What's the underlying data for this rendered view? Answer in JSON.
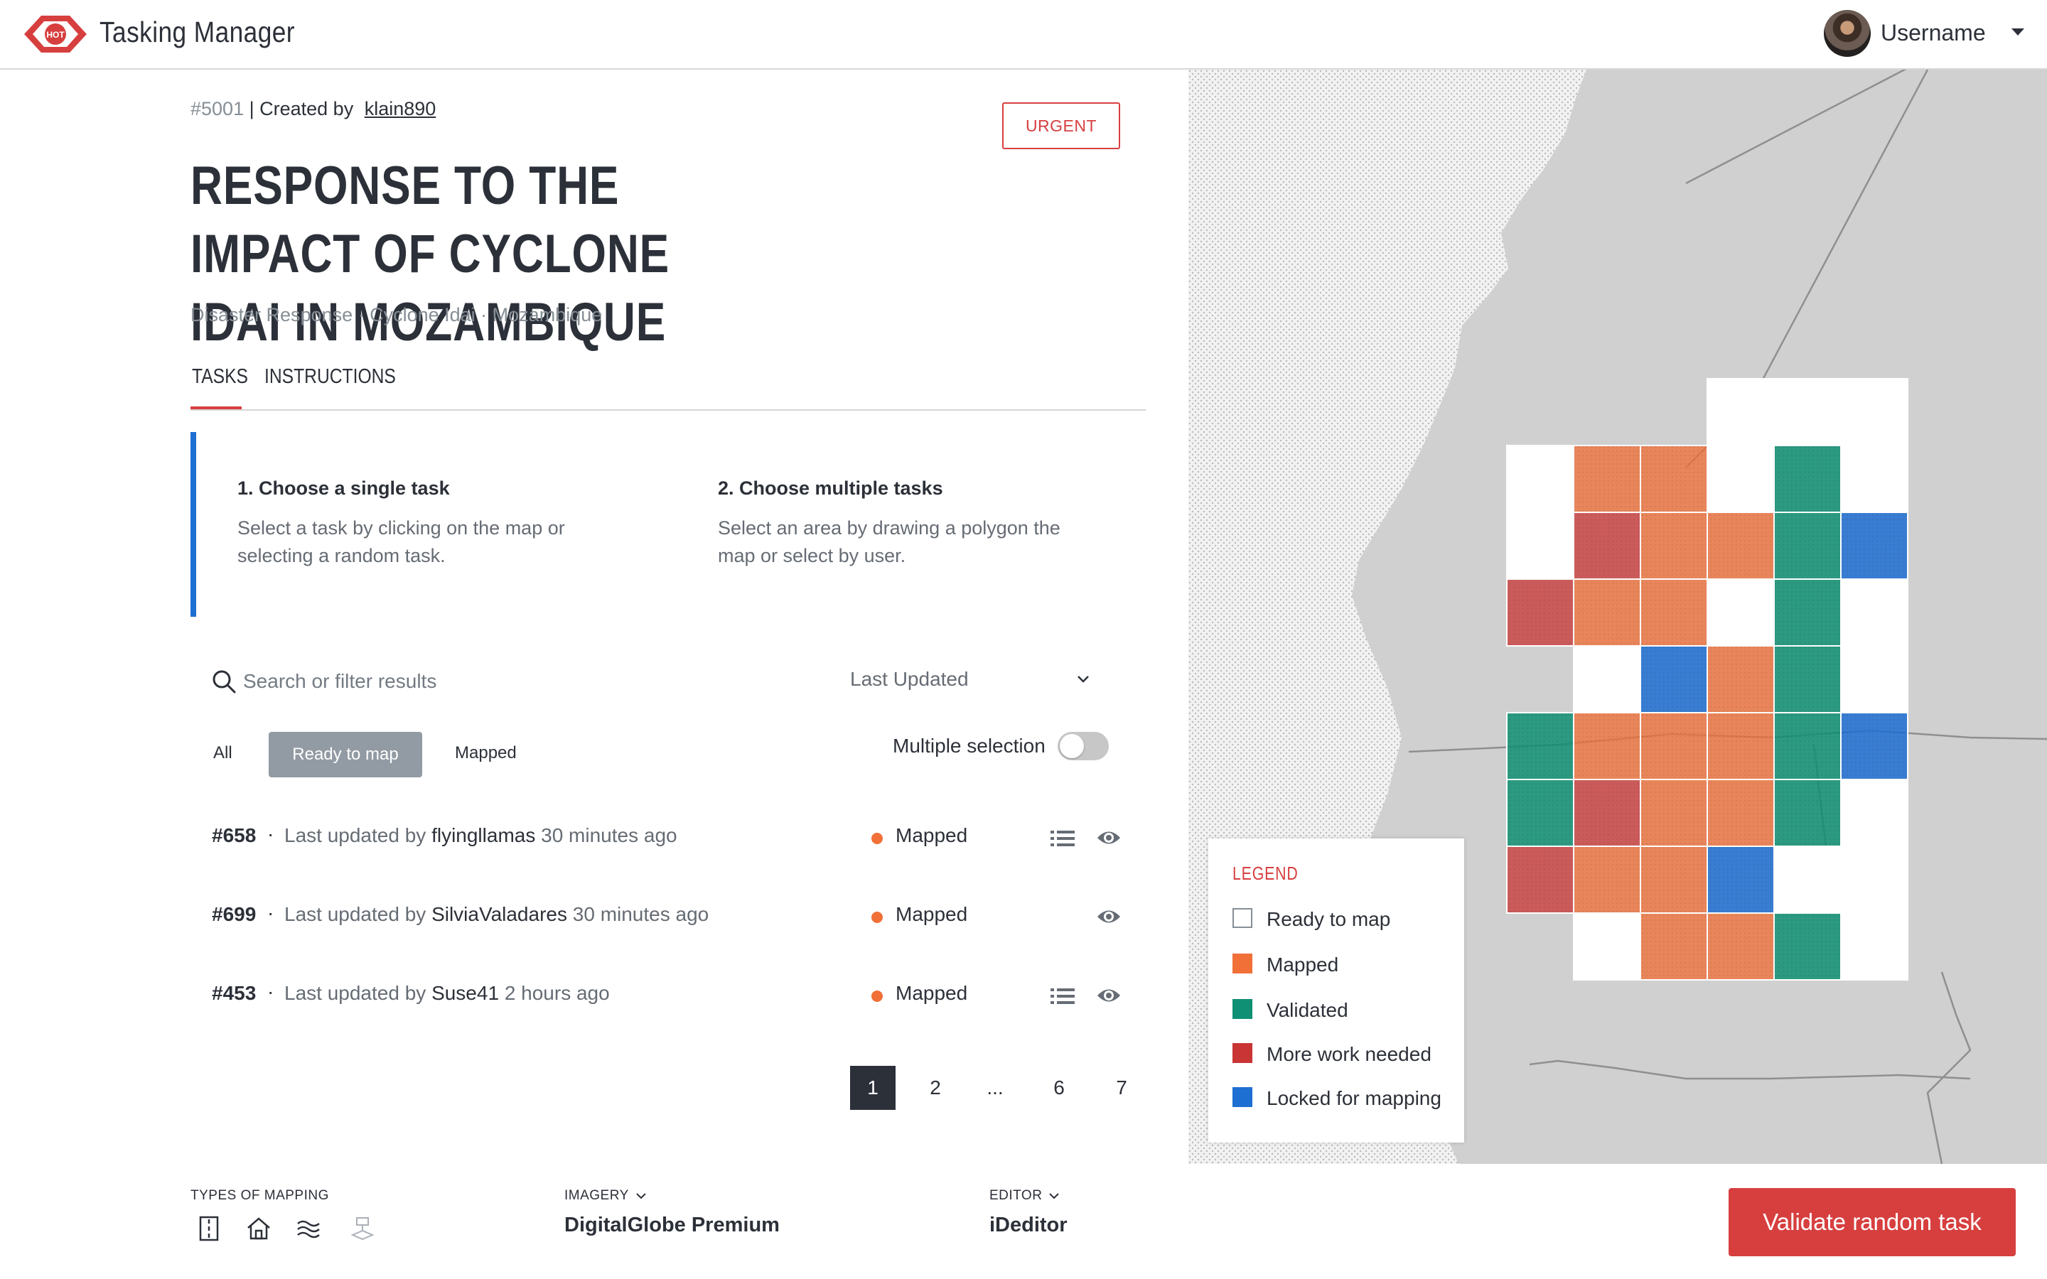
{
  "header": {
    "logo_text": "HOT",
    "app_title": "Tasking Manager",
    "username": "Username"
  },
  "project": {
    "id": "#5001",
    "created_by_label": "| Created by",
    "creator": "klain890",
    "badge": "URGENT",
    "title": "RESPONSE TO THE IMPACT OF CYCLONE IDAI IN MOZAMBIQUE",
    "tags": "Disaster Response · Cyclone Idai · Mozambique"
  },
  "tabs": [
    {
      "label": "TASKS",
      "active": true
    },
    {
      "label": "INSTRUCTIONS",
      "active": false
    }
  ],
  "info": {
    "single_title": "1. Choose a single task",
    "single_text": "Select a task by clicking on the map or selecting a random task.",
    "multi_title": "2. Choose multiple tasks",
    "multi_text": "Select an area by drawing a polygon the map or select by user."
  },
  "search": {
    "placeholder": "Search or filter results",
    "sort_label": "Last Updated"
  },
  "filters": {
    "all": "All",
    "ready": "Ready to map",
    "mapped": "Mapped",
    "active": "Ready to map"
  },
  "multiple_selection": {
    "label": "Multiple selection",
    "enabled": false
  },
  "tasks": [
    {
      "id": "#658",
      "sep": "·",
      "updated_prefix": "Last updated by",
      "user": "flyingllamas",
      "time": "30 minutes ago",
      "status": "Mapped",
      "has_list": true
    },
    {
      "id": "#699",
      "sep": "·",
      "updated_prefix": "Last updated by",
      "user": "SilviaValadares",
      "time": "30 minutes ago",
      "status": "Mapped",
      "has_list": false
    },
    {
      "id": "#453",
      "sep": "·",
      "updated_prefix": "Last updated by",
      "user": "Suse41",
      "time": "2 hours ago",
      "status": "Mapped",
      "has_list": true
    }
  ],
  "pagination": [
    "1",
    "2",
    "...",
    "6",
    "7"
  ],
  "pagination_active": "1",
  "footer": {
    "types_label": "TYPES OF MAPPING",
    "imagery_label": "IMAGERY",
    "imagery_value": "DigitalGlobe Premium",
    "editor_label": "EDITOR",
    "editor_value": "iDeditor",
    "mapping_type_icons": [
      "road-icon",
      "building-icon",
      "waterway-icon",
      "land-use-icon"
    ]
  },
  "validate_button": "Validate random task",
  "legend": {
    "title": "LEGEND",
    "items": [
      {
        "label": "Ready to map",
        "color": "#ffffff"
      },
      {
        "label": "Mapped",
        "color": "#f07038"
      },
      {
        "label": "Validated",
        "color": "#0f8f73"
      },
      {
        "label": "More work needed",
        "color": "#c93434"
      },
      {
        "label": "Locked for mapping",
        "color": "#1e6fd2"
      }
    ]
  },
  "colors": {
    "accent": "#d73f3f",
    "info_border": "#1e6fd2",
    "text": "#2c3038",
    "muted": "#868e96"
  },
  "task_grid": [
    [
      null,
      null,
      null,
      "ready",
      "ready",
      "ready"
    ],
    [
      "ready",
      "mapped",
      "mapped",
      "ready",
      "validated",
      "ready"
    ],
    [
      "ready",
      "more_work",
      "mapped",
      "mapped",
      "validated",
      "locked"
    ],
    [
      "more_work",
      "mapped",
      "mapped",
      "ready",
      "validated",
      "ready"
    ],
    [
      null,
      "ready",
      "locked",
      "mapped",
      "validated",
      "ready"
    ],
    [
      "validated",
      "mapped",
      "mapped",
      "mapped",
      "validated",
      "locked"
    ],
    [
      "validated",
      "more_work",
      "mapped",
      "mapped",
      "validated",
      "ready"
    ],
    [
      "more_work",
      "mapped",
      "mapped",
      "locked",
      "ready",
      "ready"
    ],
    [
      null,
      "ready",
      "mapped",
      "mapped",
      "validated",
      "ready"
    ]
  ]
}
